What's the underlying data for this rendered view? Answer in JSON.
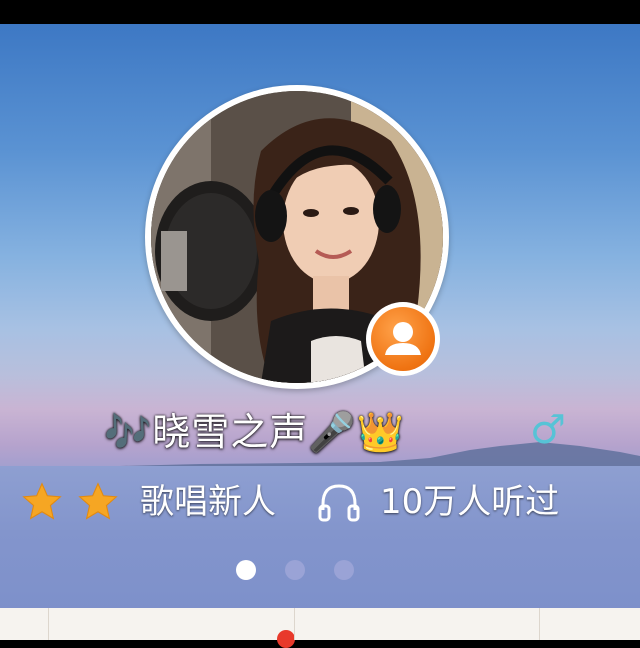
{
  "profile": {
    "nickname": "🎶晓雪之声🎤👑",
    "gender_symbol": "♂",
    "level_stars": 2,
    "level_title": "歌唱新人",
    "listen_count": "10万人听过"
  },
  "icons": {
    "profile_badge": "person-icon",
    "headphones": "headphones-icon",
    "location": "location-pin-icon",
    "star": "star-icon"
  },
  "carousel": {
    "page_count": 3,
    "active_index": 0
  },
  "colors": {
    "gender": "#57c3d6",
    "badge": "#ef7312",
    "star": "#f6a623",
    "dot_active": "#ffffff",
    "dot_inactive": "#9aa3d6",
    "location_pin": "#e8392b"
  }
}
